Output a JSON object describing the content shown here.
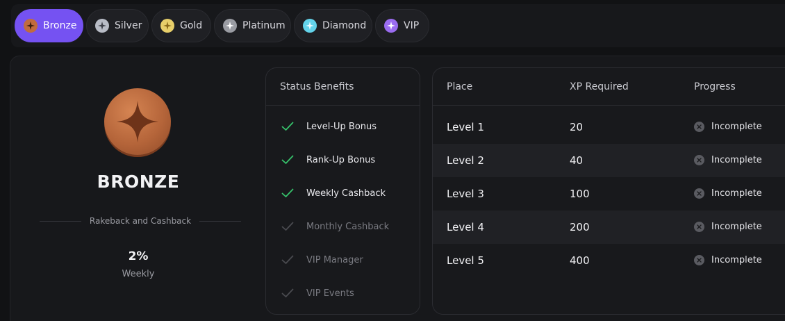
{
  "tabs": [
    {
      "label": "Bronze",
      "icon": "bronze-star-icon",
      "color": "#c06b3e",
      "active": true
    },
    {
      "label": "Silver",
      "icon": "silver-star-icon",
      "color": "#b8bcc6",
      "active": false
    },
    {
      "label": "Gold",
      "icon": "gold-star-icon",
      "color": "#e8cf6a",
      "active": false
    },
    {
      "label": "Platinum",
      "icon": "platinum-star-icon",
      "color": "#9a9ca3",
      "active": false
    },
    {
      "label": "Diamond",
      "icon": "diamond-star-icon",
      "color": "#63d3ea",
      "active": false
    },
    {
      "label": "VIP",
      "icon": "vip-star-icon",
      "color": "#9a6cf0",
      "active": false
    }
  ],
  "tier": {
    "title": "BRONZE",
    "medal_icon": "bronze-medal-icon",
    "subtitle": "Rakeback and Cashback",
    "percent": "2%",
    "period": "Weekly"
  },
  "benefits": {
    "heading": "Status Benefits",
    "items": [
      {
        "label": "Level-Up Bonus",
        "enabled": true
      },
      {
        "label": "Rank-Up Bonus",
        "enabled": true
      },
      {
        "label": "Weekly Cashback",
        "enabled": true
      },
      {
        "label": "Monthly Cashback",
        "enabled": false
      },
      {
        "label": "VIP Manager",
        "enabled": false
      },
      {
        "label": "VIP Events",
        "enabled": false
      }
    ]
  },
  "levels": {
    "headers": [
      "Place",
      "XP Required",
      "Progress"
    ],
    "rows": [
      {
        "place": "Level 1",
        "xp": "20",
        "progress": "Incomplete"
      },
      {
        "place": "Level 2",
        "xp": "40",
        "progress": "Incomplete"
      },
      {
        "place": "Level 3",
        "xp": "100",
        "progress": "Incomplete"
      },
      {
        "place": "Level 4",
        "xp": "200",
        "progress": "Incomplete"
      },
      {
        "place": "Level 5",
        "xp": "400",
        "progress": "Incomplete"
      }
    ]
  },
  "colors": {
    "accent": "#7552f2",
    "check_on": "#36c26b",
    "check_off": "#4a4b50"
  }
}
